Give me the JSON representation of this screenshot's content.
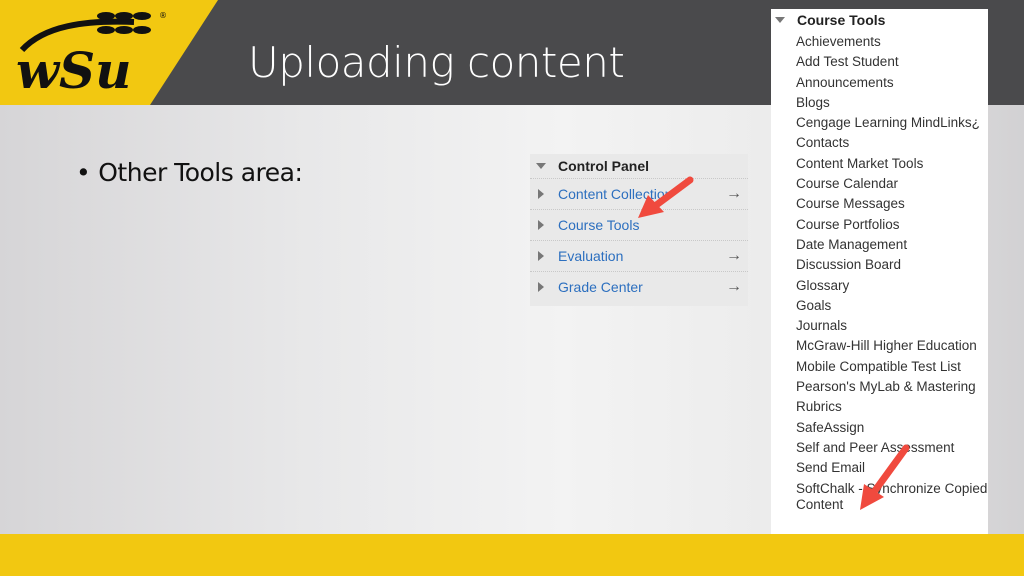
{
  "slide": {
    "title": "Uploading content",
    "bullet": "Other Tools area:",
    "bullet_marker": "•",
    "colors": {
      "brand_yellow": "#f2c811",
      "header_gray": "#4a4a4c",
      "link_blue": "#2c6fbf",
      "arrow_red": "#f04a3e"
    }
  },
  "logo": {
    "text": "wSu",
    "registered": "®"
  },
  "control_panel": {
    "heading": "Control Panel",
    "items": [
      {
        "label": "Content Collection",
        "arrow": "→"
      },
      {
        "label": "Course Tools",
        "arrow": ""
      },
      {
        "label": "Evaluation",
        "arrow": "→"
      },
      {
        "label": "Grade Center",
        "arrow": "→"
      }
    ]
  },
  "course_tools": {
    "heading": "Course Tools",
    "items": [
      "Achievements",
      "Add Test Student",
      "Announcements",
      "Blogs",
      "Cengage Learning MindLinks¿",
      "Contacts",
      "Content Market Tools",
      "Course Calendar",
      "Course Messages",
      "Course Portfolios",
      "Date Management",
      "Discussion Board",
      "Glossary",
      "Goals",
      "Journals",
      "McGraw-Hill Higher Education",
      "Mobile Compatible Test List",
      "Pearson's MyLab & Mastering",
      "Rubrics",
      "SafeAssign",
      "Self and Peer Assessment",
      "Send Email",
      "SoftChalk - Synchronize Copied Content"
    ]
  }
}
